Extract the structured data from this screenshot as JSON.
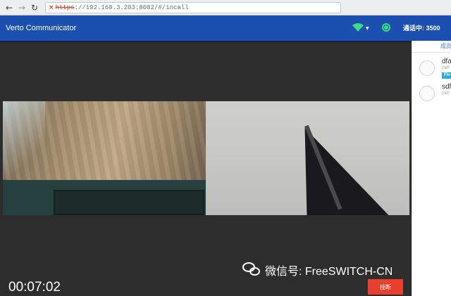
{
  "browser": {
    "back_icon": "arrow-left-icon",
    "forward_icon": "arrow-right-icon",
    "reload_icon": "reload-icon",
    "url_scheme": "https",
    "url_rest": "://192.168.3.203:8082/#/incall"
  },
  "header": {
    "title": "Verto Communicator",
    "status_text": "通话中: 3500",
    "wifi_color": "#3ddc84",
    "status_color": "#3ddc84",
    "brand_color": "#1b4fb0"
  },
  "call": {
    "timer": "00:07:02",
    "hangup_label": "挂断",
    "hangup_color": "#e8402e"
  },
  "members": {
    "tab_label": "成员",
    "items": [
      {
        "name": "dfa",
        "email": "(sdf",
        "badge": "Flo"
      },
      {
        "name": "sdf",
        "email": "(sdf",
        "badge": ""
      }
    ]
  },
  "watermark": {
    "text": "微信号: FreeSWITCH-CN"
  }
}
